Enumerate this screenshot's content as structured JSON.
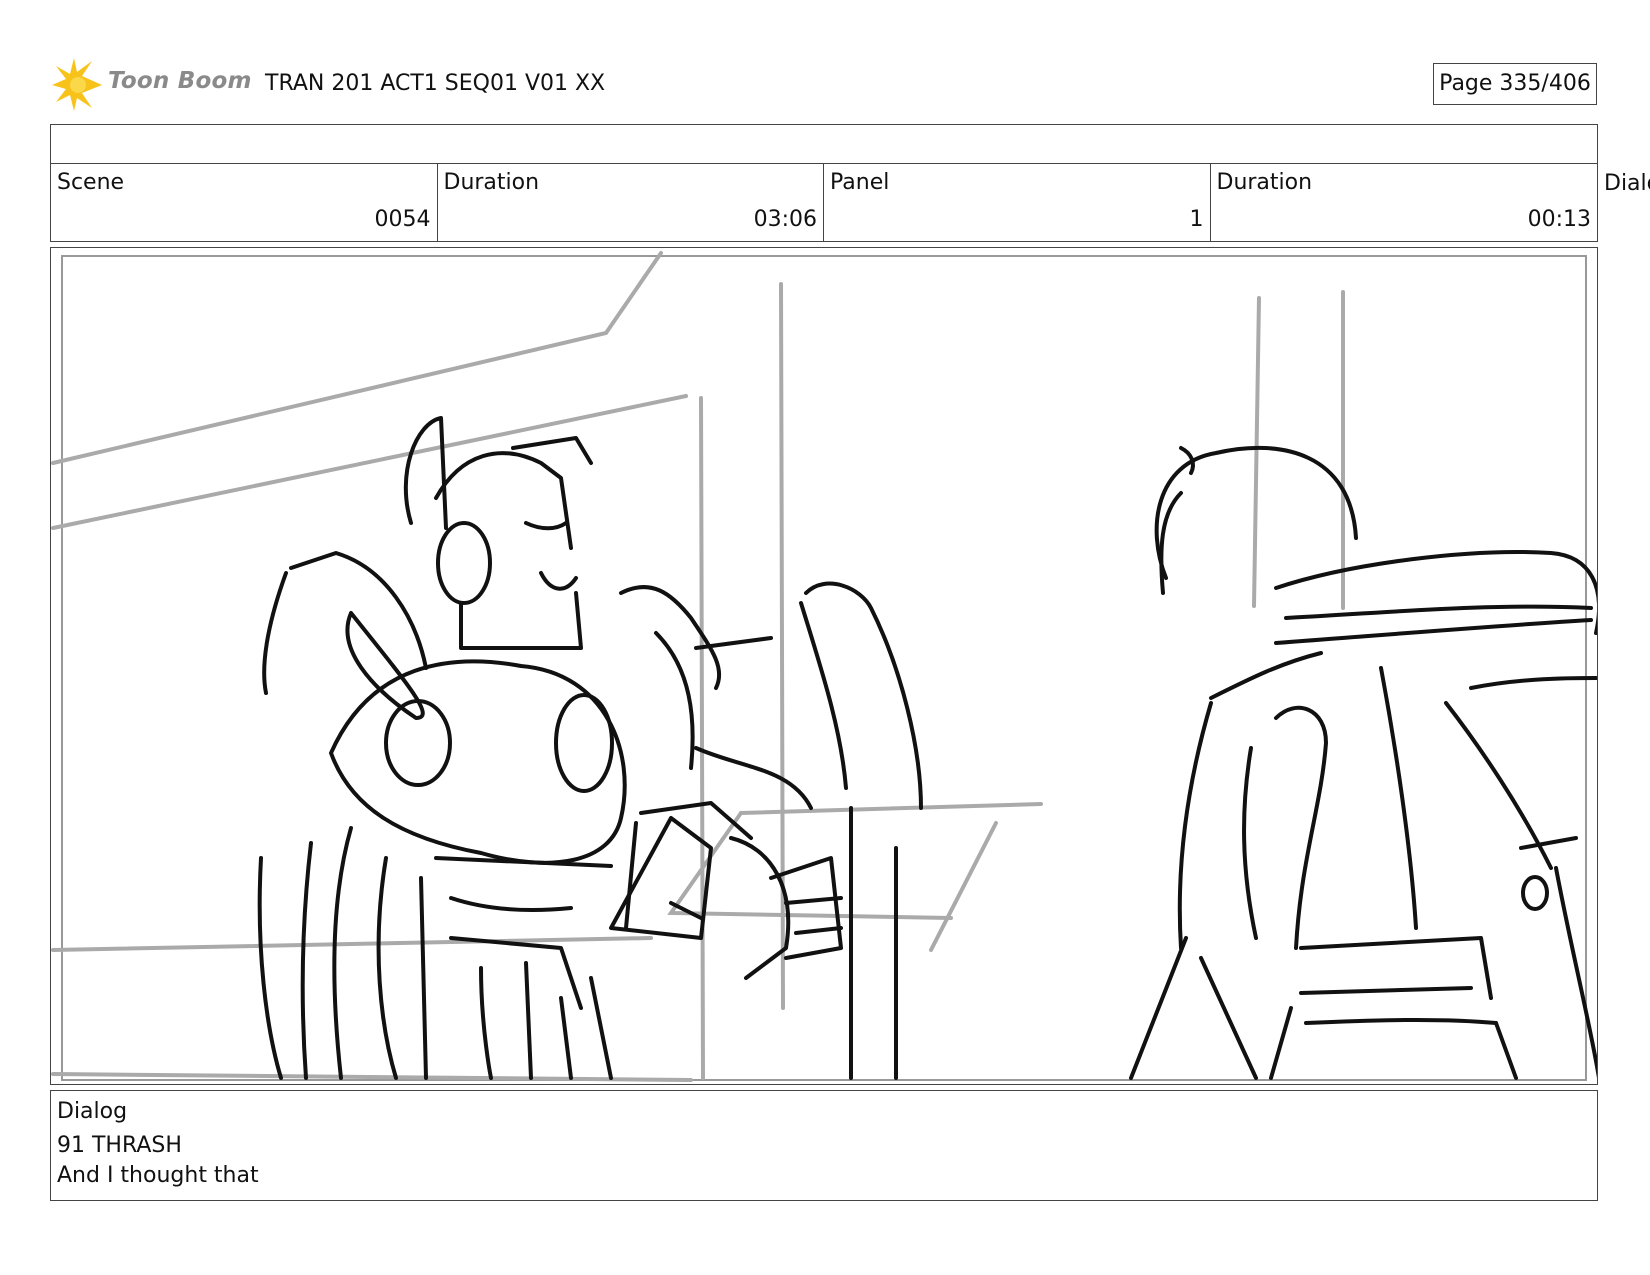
{
  "header": {
    "logo_text": "Toon Boom",
    "doc_title": "TRAN 201 ACT1 SEQ01 V01 XX",
    "page_label": "Page 335/406"
  },
  "info": {
    "scene_label": "Scene",
    "scene_value": "0054",
    "scene_duration_label": "Duration",
    "scene_duration_value": "03:06",
    "panel_label": "Panel",
    "panel_value": "1",
    "panel_duration_label": "Duration",
    "panel_duration_value": "00:13",
    "overflow_label": "Dialog"
  },
  "dialog": {
    "label": "Dialog",
    "speaker": "91 THRASH",
    "line": "And I thought that"
  }
}
